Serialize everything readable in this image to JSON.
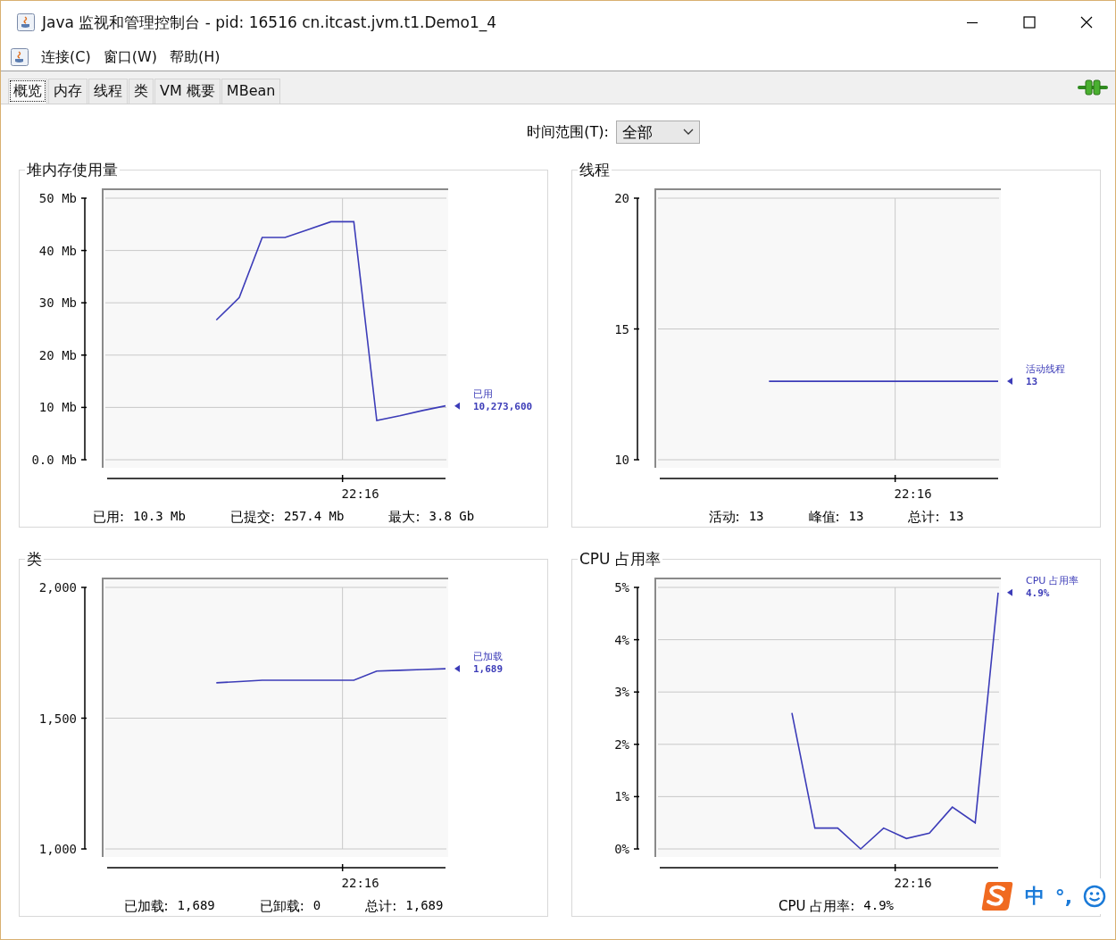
{
  "window": {
    "title": "Java 监视和管理控制台 - pid: 16516 cn.itcast.jvm.t1.Demo1_4"
  },
  "menu": [
    "连接(C)",
    "窗口(W)",
    "帮助(H)"
  ],
  "tabs": [
    {
      "label": "概览",
      "selected": true
    },
    {
      "label": "内存",
      "selected": false
    },
    {
      "label": "线程",
      "selected": false
    },
    {
      "label": "类",
      "selected": false
    },
    {
      "label": "VM 概要",
      "selected": false
    },
    {
      "label": "MBean",
      "selected": false
    }
  ],
  "time_range": {
    "label": "时间范围(T):",
    "value": "全部"
  },
  "panels": [
    {
      "title": "堆内存使用量",
      "legend_value": "10,273,600",
      "time_label": "22:16",
      "chart_data": {
        "type": "line",
        "grid": true,
        "ylim": [
          0,
          50
        ],
        "yticks": [
          {
            "value": 0,
            "label": "0.0 Mb"
          },
          {
            "value": 10,
            "label": "10 Mb"
          },
          {
            "value": 20,
            "label": "20 Mb"
          },
          {
            "value": 30,
            "label": "30 Mb"
          },
          {
            "value": 40,
            "label": "40 Mb"
          },
          {
            "value": 50,
            "label": "50 Mb"
          }
        ],
        "series": [
          {
            "name": "已用",
            "color": "#3c3cb8",
            "values": [
              null,
              null,
              null,
              null,
              null,
              26.7,
              31,
              42.5,
              42.5,
              44,
              45.5,
              45.5,
              7.5,
              8.4,
              9.4,
              10.3
            ]
          }
        ]
      },
      "summary": [
        {
          "label": "已用:",
          "value": "10.3 Mb"
        },
        {
          "label": "已提交:",
          "value": "257.4 Mb"
        },
        {
          "label": "最大:",
          "value": "3.8 Gb"
        }
      ]
    },
    {
      "title": "线程",
      "legend_value": "13",
      "time_label": "22:16",
      "chart_data": {
        "type": "line",
        "grid": true,
        "ylim": [
          10,
          20
        ],
        "yticks": [
          {
            "value": 10,
            "label": "10"
          },
          {
            "value": 15,
            "label": "15"
          },
          {
            "value": 20,
            "label": "20"
          }
        ],
        "series": [
          {
            "name": "活动线程",
            "color": "#3c3cb8",
            "values": [
              null,
              null,
              null,
              null,
              null,
              13,
              13,
              13,
              13,
              13,
              13,
              13,
              13,
              13,
              13,
              13
            ]
          }
        ]
      },
      "summary": [
        {
          "label": "活动:",
          "value": "13"
        },
        {
          "label": "峰值:",
          "value": "13"
        },
        {
          "label": "总计:",
          "value": "13"
        }
      ]
    },
    {
      "title": "类",
      "legend_value": "1,689",
      "time_label": "22:16",
      "chart_data": {
        "type": "line",
        "grid": true,
        "ylim": [
          1000,
          2000
        ],
        "yticks": [
          {
            "value": 1000,
            "label": "1,000"
          },
          {
            "value": 1500,
            "label": "1,500"
          },
          {
            "value": 2000,
            "label": "2,000"
          }
        ],
        "series": [
          {
            "name": "已加载",
            "color": "#3c3cb8",
            "values": [
              null,
              null,
              null,
              null,
              null,
              1635,
              1640,
              1645,
              1645,
              1645,
              1645,
              1645,
              1680,
              1683,
              1686,
              1689
            ]
          }
        ]
      },
      "summary": [
        {
          "label": "已加载:",
          "value": "1,689"
        },
        {
          "label": "已卸载:",
          "value": "0"
        },
        {
          "label": "总计:",
          "value": "1,689"
        }
      ]
    },
    {
      "title": "CPU 占用率",
      "legend_value": "4.9%",
      "time_label": "22:16",
      "chart_data": {
        "type": "line",
        "grid": true,
        "ylim": [
          0,
          5
        ],
        "yticks": [
          {
            "value": 0,
            "label": "0%"
          },
          {
            "value": 1,
            "label": "1%"
          },
          {
            "value": 2,
            "label": "2%"
          },
          {
            "value": 3,
            "label": "3%"
          },
          {
            "value": 4,
            "label": "4%"
          },
          {
            "value": 5,
            "label": "5%"
          }
        ],
        "series": [
          {
            "name": "CPU 占用率",
            "color": "#3c3cb8",
            "values": [
              null,
              null,
              null,
              null,
              null,
              null,
              2.6,
              0.4,
              0.4,
              0.0,
              0.4,
              0.2,
              0.3,
              0.8,
              0.5,
              4.9
            ]
          }
        ]
      },
      "summary": [
        {
          "label": "CPU 占用率:",
          "value": "4.9%"
        }
      ]
    }
  ],
  "ime_bar": {
    "mode": "中",
    "punctuation": "°,"
  }
}
